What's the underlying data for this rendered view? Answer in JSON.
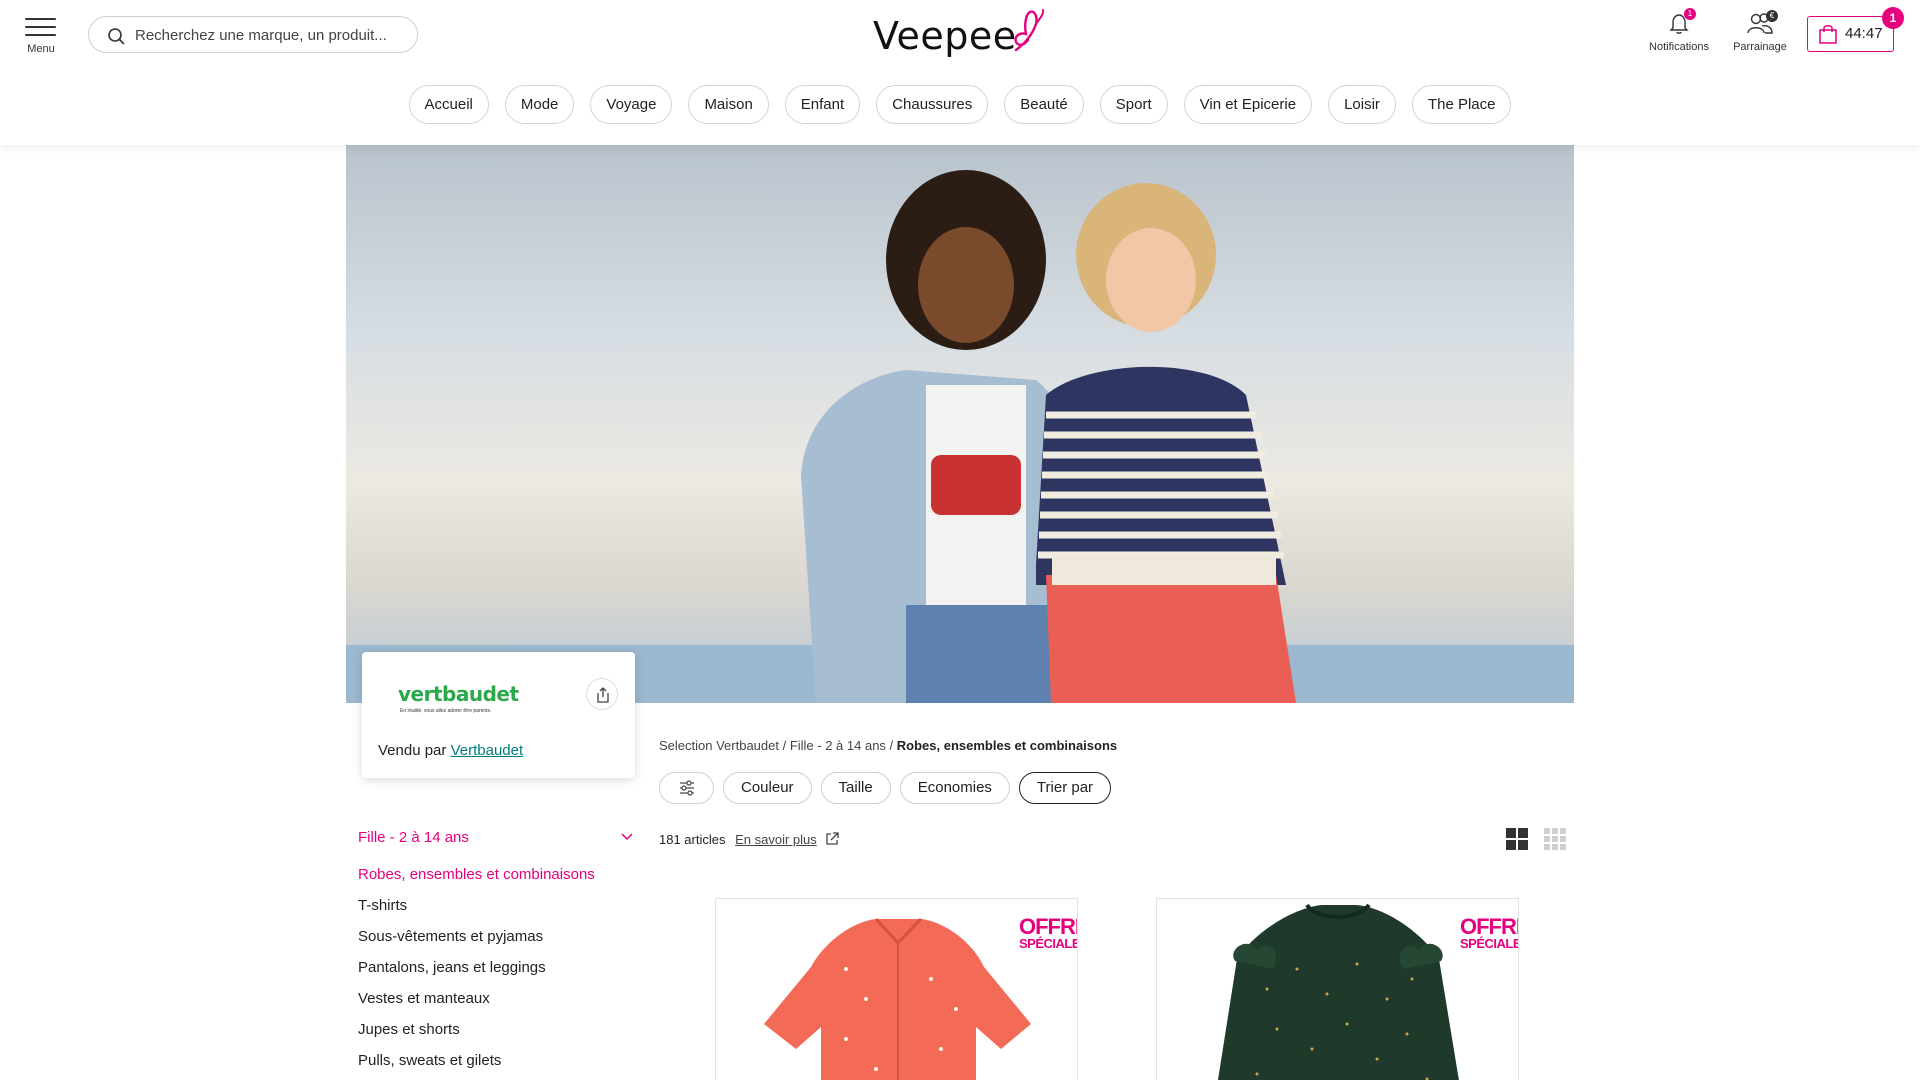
{
  "header": {
    "menu_label": "Menu",
    "search_placeholder": "Recherchez une marque, un produit...",
    "logo_text": "Veepee",
    "notifications_label": "Notifications",
    "notifications_count": "1",
    "referral_label": "Parrainage",
    "referral_count": "€",
    "cart_timer": "44:47",
    "cart_count": "1",
    "brand_color": "#e5007e"
  },
  "nav": {
    "items": [
      "Accueil",
      "Mode",
      "Voyage",
      "Maison",
      "Enfant",
      "Chaussures",
      "Beauté",
      "Sport",
      "Vin et Epicerie",
      "Loisir",
      "The Place"
    ]
  },
  "seller": {
    "brand_name": "vertbaudet",
    "tagline": "En réalité, vous allez adorer être parents.",
    "sold_by_prefix": "Vendu par",
    "sold_by_link": "Vertbaudet"
  },
  "sidebar": {
    "heading": "Fille - 2 à 14 ans",
    "items": [
      "Robes, ensembles et combinaisons",
      "T-shirts",
      "Sous-vêtements et pyjamas",
      "Pantalons, jeans et leggings",
      "Vestes et manteaux",
      "Jupes et shorts",
      "Pulls, sweats et gilets"
    ],
    "active_index": 0
  },
  "breadcrumb": {
    "part1": "Selection Vertbaudet",
    "part2": "Fille - 2 à 14 ans",
    "current": "Robes, ensembles et combinaisons"
  },
  "filters": {
    "color": "Couleur",
    "size": "Taille",
    "savings": "Economies",
    "sort": "Trier par"
  },
  "results": {
    "count": "181 articles",
    "learn_more": "En savoir plus"
  },
  "products": [
    {
      "badge_line1": "OFFRE",
      "badge_line2": "SPÉCIALE"
    },
    {
      "badge_line1": "OFFRE",
      "badge_line2": "SPÉCIALE"
    }
  ]
}
